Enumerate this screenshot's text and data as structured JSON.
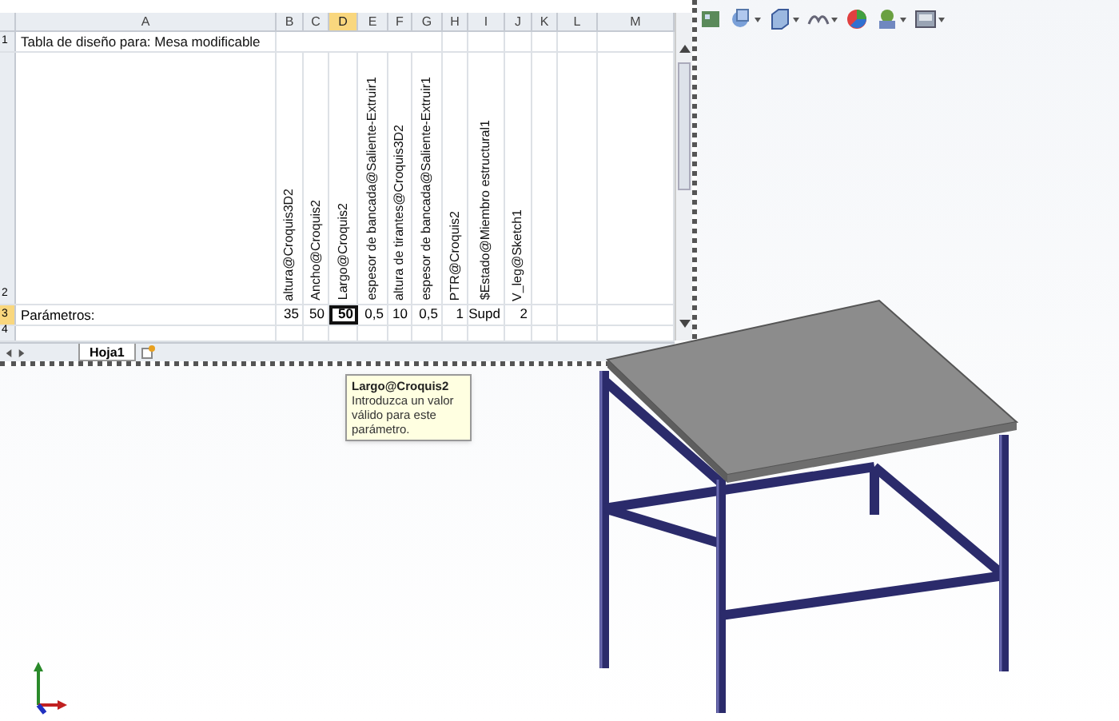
{
  "spreadsheet": {
    "columns": [
      {
        "label": "A",
        "selected": false
      },
      {
        "label": "B",
        "selected": false
      },
      {
        "label": "C",
        "selected": false
      },
      {
        "label": "D",
        "selected": true
      },
      {
        "label": "E",
        "selected": false
      },
      {
        "label": "F",
        "selected": false
      },
      {
        "label": "G",
        "selected": false
      },
      {
        "label": "H",
        "selected": false
      },
      {
        "label": "I",
        "selected": false
      },
      {
        "label": "J",
        "selected": false
      },
      {
        "label": "K",
        "selected": false
      },
      {
        "label": "L",
        "selected": false
      },
      {
        "label": "M",
        "selected": false
      }
    ],
    "rows": [
      {
        "label": "1",
        "selected": false
      },
      {
        "label": "2",
        "selected": false
      },
      {
        "label": "3",
        "selected": true
      },
      {
        "label": "4",
        "selected": false
      }
    ],
    "title": "Tabla de diseño para: Mesa modificable",
    "parameter_names": [
      "altura@Croquis3D2",
      "Ancho@Croquis2",
      "Largo@Croquis2",
      "espesor de bancada@Saliente-Extruir1",
      "altura de tirantes@Croquis3D2",
      "espesor de bancada@Saliente-Extruir1",
      "PTR@Croquis2",
      "$Estado@Miembro estructural1",
      "V_leg@Sketch1"
    ],
    "row_label": "Parámetros:",
    "values": [
      {
        "text": "35",
        "selected": false
      },
      {
        "text": "50",
        "selected": false
      },
      {
        "text": "50",
        "selected": true
      },
      {
        "text": "0,5",
        "selected": false
      },
      {
        "text": "10",
        "selected": false
      },
      {
        "text": "0,5",
        "selected": false
      },
      {
        "text": "1",
        "selected": false
      },
      {
        "text": "Supd",
        "selected": false
      },
      {
        "text": "2",
        "selected": false
      }
    ],
    "sheet_tab": "Hoja1"
  },
  "tooltip": {
    "title": "Largo@Croquis2",
    "text": "Introduzca un valor válido para este parámetro."
  }
}
